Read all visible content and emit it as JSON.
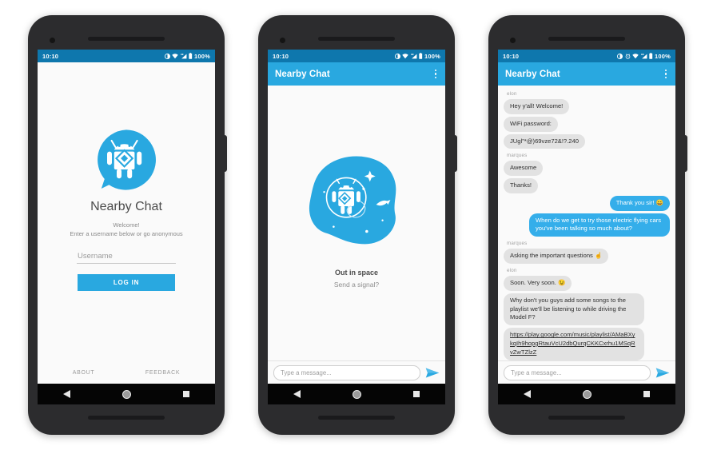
{
  "app": {
    "name": "Nearby Chat",
    "accent_blue": "#29a8e0",
    "statusbar_blue": "#0e77ad",
    "bubble_in": "#e2e2e2",
    "bubble_out": "#34aeea"
  },
  "status_bar": {
    "time": "10:10",
    "battery": "100%",
    "icons_screen1": [
      "dnd-icon",
      "wifi-icon",
      "signal-icon",
      "battery-icon"
    ],
    "icons_screen3": [
      "dnd-icon",
      "alarm-icon",
      "wifi-icon",
      "signal-icon",
      "battery-icon"
    ]
  },
  "screen1": {
    "logo_icon": "nearby-chat-android-logo",
    "app_title": "Nearby Chat",
    "welcome_line1": "Welcome!",
    "welcome_line2": "Enter a username below or go anonymous",
    "username_placeholder": "Username",
    "username_value": "",
    "login_label": "LOG IN",
    "about_label": "ABOUT",
    "feedback_label": "FEEDBACK"
  },
  "screen2": {
    "appbar_title": "Nearby Chat",
    "overflow_icon": "kebab-menu-icon",
    "illustration": "astronaut-android-in-space",
    "empty_title": "Out in space",
    "empty_subtitle": "Send a signal?",
    "composer_placeholder": "Type a message...",
    "composer_value": "",
    "send_icon": "send-icon"
  },
  "screen3": {
    "appbar_title": "Nearby Chat",
    "overflow_icon": "kebab-menu-icon",
    "composer_placeholder": "Type a message...",
    "composer_value": "",
    "send_icon": "send-icon",
    "messages": [
      {
        "sender": "elon",
        "show_sender": true,
        "side": "in",
        "text": "Hey y'all! Welcome!"
      },
      {
        "sender": "elon",
        "show_sender": false,
        "side": "in",
        "text": "WiFi password:"
      },
      {
        "sender": "elon",
        "show_sender": false,
        "side": "in",
        "text": "JUgl\"*@)69vze72&!?.240"
      },
      {
        "sender": "marques",
        "show_sender": true,
        "side": "in",
        "text": "Awesome"
      },
      {
        "sender": "marques",
        "show_sender": false,
        "side": "in",
        "text": "Thanks!"
      },
      {
        "sender": "me",
        "show_sender": false,
        "side": "out",
        "text": "Thank you sir! 😄"
      },
      {
        "sender": "me",
        "show_sender": false,
        "side": "out",
        "text": "When do we get to try those electric flying cars you've been talking so much about?"
      },
      {
        "sender": "marques",
        "show_sender": true,
        "side": "in",
        "text": "Asking the important questions ☝️"
      },
      {
        "sender": "elon",
        "show_sender": true,
        "side": "in",
        "text": "Soon. Very soon. 😉"
      },
      {
        "sender": "elon",
        "show_sender": false,
        "side": "in",
        "text": "Why don't you guys add some songs to the playlist we'll be listening to while driving the Model F?"
      },
      {
        "sender": "elon",
        "show_sender": false,
        "side": "in",
        "link": true,
        "text": "https://play.google.com/music/playlist/AMaBXykqIh9hopgRtauVcU2dbQurqCKKCxrhu1MSqRvZwTZlzZ"
      }
    ]
  }
}
